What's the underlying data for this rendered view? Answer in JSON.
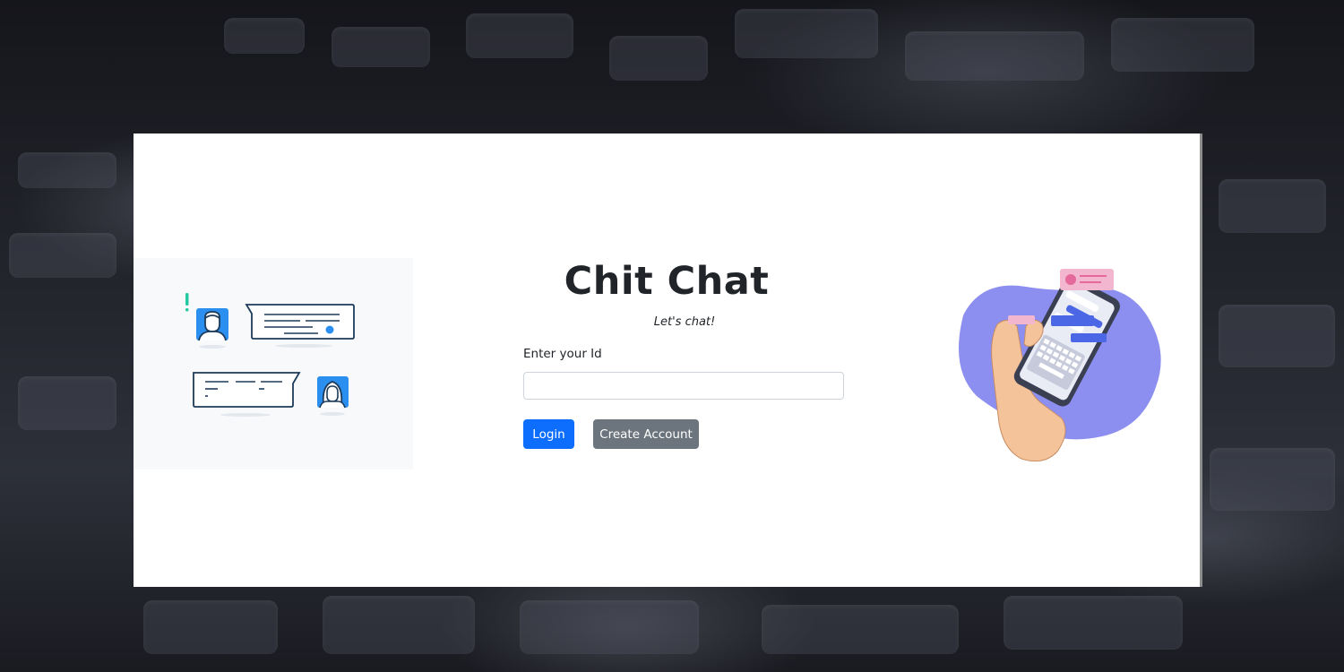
{
  "app": {
    "title": "Chit Chat",
    "tagline": "Let's chat!"
  },
  "login_form": {
    "id_label": "Enter your Id",
    "id_value": "",
    "id_placeholder": "",
    "login_label": "Login",
    "create_account_label": "Create Account"
  },
  "colors": {
    "primary": "#0d6efd",
    "secondary": "#6c757d",
    "text": "#212529",
    "card_background": "#ffffff"
  },
  "illustrations": {
    "left": "two-person-chat-bubbles-illustration",
    "right": "hand-holding-phone-chat-illustration"
  }
}
